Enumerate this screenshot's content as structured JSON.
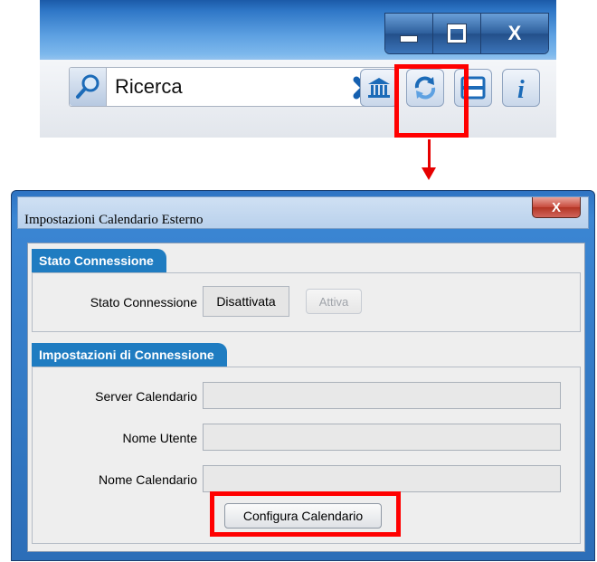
{
  "toolbar": {
    "search_placeholder": "Ricerca",
    "window_buttons": {
      "minimize": "minimize",
      "maximize": "maximize",
      "close": "X"
    },
    "icons": [
      "search-icon",
      "clear-search-icon",
      "bank-icon",
      "sync-calendar-icon",
      "print-icon",
      "info-icon"
    ]
  },
  "dialog": {
    "title": "Impostazioni Calendario Esterno",
    "close_label": "X",
    "section_status": {
      "title": "Stato Connessione",
      "label": "Stato Connessione",
      "value": "Disattivata",
      "activate_button": "Attiva"
    },
    "section_settings": {
      "title": "Impostazioni di Connessione",
      "server_label": "Server Calendario",
      "server_value": "",
      "username_label": "Nome Utente",
      "username_value": "",
      "calendar_label": "Nome Calendario",
      "calendar_value": "",
      "configure_button": "Configura Calendario"
    }
  },
  "colors": {
    "highlight": "#ff0000",
    "section_tab": "#1f7cc1",
    "window_frame": "#2f74c3"
  }
}
